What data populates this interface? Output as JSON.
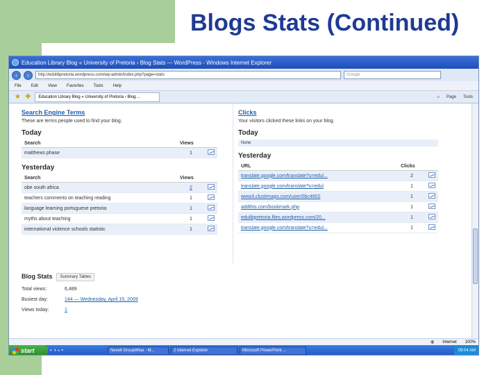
{
  "slide": {
    "title": "Blogs Stats (Continued)"
  },
  "browser": {
    "window_title": "Education Library Blog « University of Pretoria › Blog Stats — WordPress - Windows Internet Explorer",
    "url": "http://edulibpretoria.wordpress.com/wp-admin/index.php?page=stats",
    "search_placeholder": "Google",
    "menu": [
      "File",
      "Edit",
      "View",
      "Favorites",
      "Tools",
      "Help"
    ],
    "tab_label": "Education Library Blog « University of Pretoria › Blog ...",
    "tools": [
      "Page",
      "Tools"
    ],
    "status": {
      "zone": "Internet",
      "zoom": "100%"
    }
  },
  "search_terms": {
    "title": "Search Engine Terms",
    "description": "These are terms people used to find your blog.",
    "today_heading": "Today",
    "columns": [
      "Search",
      "Views"
    ],
    "today_rows": [
      {
        "term": "matthews phase",
        "views": "1"
      }
    ],
    "yesterday_heading": "Yesterday",
    "yesterday_rows": [
      {
        "term": "obe south africa",
        "views": "2"
      },
      {
        "term": "teachers comments on teaching reading",
        "views": "1"
      },
      {
        "term": "language learning portuguese pretoria",
        "views": "1"
      },
      {
        "term": "myths about teaching",
        "views": "1"
      },
      {
        "term": "international violence schools statistic",
        "views": "1"
      }
    ]
  },
  "clicks": {
    "title": "Clicks",
    "description": "Your visitors clicked these links on your blog.",
    "today_heading": "Today",
    "today_none": "None",
    "yesterday_heading": "Yesterday",
    "columns": [
      "URL",
      "Clicks"
    ],
    "yesterday_rows": [
      {
        "url": "translate.google.com/translate?u=edul...",
        "clicks": "2"
      },
      {
        "url": "translate.google.com/translate?u=edul",
        "clicks": "1"
      },
      {
        "url": "www3.clustrmaps.com/user/0bc4602",
        "clicks": "1"
      },
      {
        "url": "addthis.com/bookmark.php",
        "clicks": "1"
      },
      {
        "url": "edulibpretoria.files.wordpress.com/20...",
        "clicks": "1"
      },
      {
        "url": "translate.google.com/translate?u=edul...",
        "clicks": "1"
      }
    ]
  },
  "blog_stats": {
    "title": "Blog Stats",
    "tab": "Summary Tables",
    "total_views_label": "Total views:",
    "total_views": "6,489",
    "busiest_day_label": "Busiest day:",
    "busiest_day": "144 — Wednesday, April 15, 2009",
    "views_today_label": "Views today:",
    "views_today": "1"
  },
  "taskbar": {
    "start": "start",
    "tasks": [
      "Novell GroupWise - M...",
      "2 Internet Explorer",
      "Microsoft PowerPoint ..."
    ],
    "clock": "09:04 AM"
  }
}
